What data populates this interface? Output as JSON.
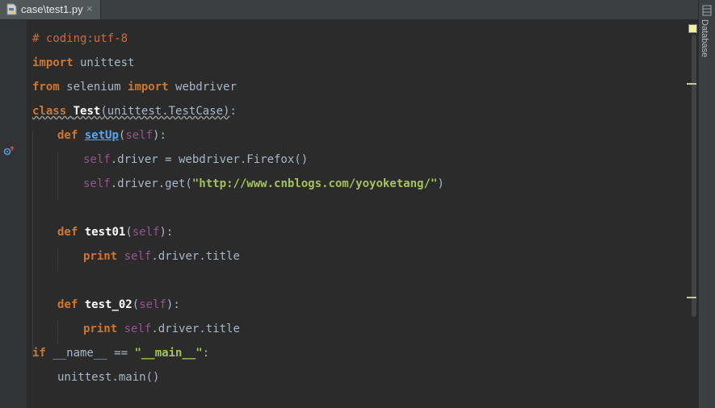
{
  "tab": {
    "label": "case\\test1.py",
    "close": "×",
    "icon": "python-file-icon"
  },
  "toolwindow": {
    "label": "Database",
    "icon": "database-icon"
  },
  "gutter": {
    "override_icon": "override-method-icon"
  },
  "code": {
    "l1": "# coding:utf-8",
    "l2_kw": "import",
    "l2_rest": " unittest",
    "l3_kw1": "from",
    "l3_mid": " selenium ",
    "l3_kw2": "import",
    "l3_rest": " webdriver",
    "l4_kw": "class",
    "l4_sp": " ",
    "l4_cls": "Test",
    "l4_base": "(unittest.TestCase)",
    "l4_end": ":",
    "l5_kw": "def",
    "l5_sp": " ",
    "l5_fn": "setUp",
    "l5_open": "(",
    "l5_self": "self",
    "l5_close": "):",
    "l6_self": "self",
    "l6_rest": ".driver = webdriver.Firefox()",
    "l7_self": "self",
    "l7_rest": ".driver.get(",
    "l7_str": "\"http://www.cnblogs.com/yoyoketang/\"",
    "l7_close": ")",
    "l8_kw": "def",
    "l8_sp": " ",
    "l8_fn": "test01",
    "l8_open": "(",
    "l8_self": "self",
    "l8_close": "):",
    "l9_kw": "print",
    "l9_sp": " ",
    "l9_self": "self",
    "l9_rest": ".driver.title",
    "l10_kw": "def",
    "l10_sp": " ",
    "l10_fn": "test_02",
    "l10_open": "(",
    "l10_self": "self",
    "l10_close": "):",
    "l11_kw": "print",
    "l11_sp": " ",
    "l11_self": "self",
    "l11_rest": ".driver.title",
    "l12_kw": "if",
    "l12_mid": " __name__ == ",
    "l12_str": "\"__main__\"",
    "l12_end": ":",
    "l13": "unittest.main()"
  },
  "colors": {
    "background": "#2b2b2b",
    "keyword": "#cc7832",
    "comment": "#cc6a48",
    "self": "#94558d",
    "string": "#a5c25c",
    "text": "#a9b7c6"
  }
}
